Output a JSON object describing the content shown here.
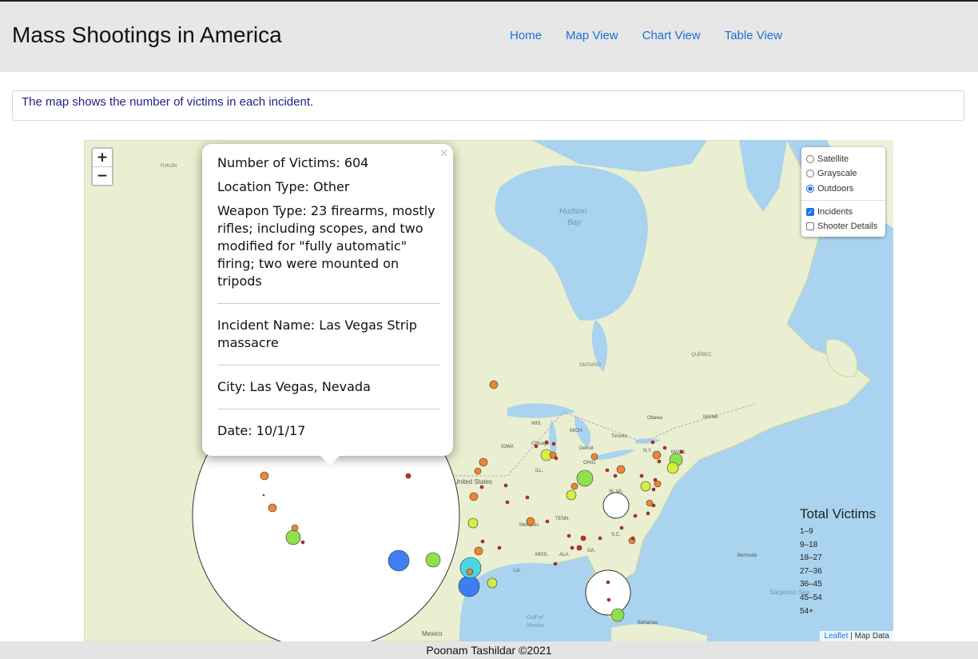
{
  "header": {
    "title": "Mass Shootings in America",
    "nav": [
      "Home",
      "Map View",
      "Chart View",
      "Table View"
    ]
  },
  "info": {
    "text": "The map shows the number of victims in each incident."
  },
  "map": {
    "zoom_in": "+",
    "zoom_out": "−",
    "layer_control": {
      "base_layers": [
        {
          "label": "Satellite",
          "selected": false
        },
        {
          "label": "Grayscale",
          "selected": false
        },
        {
          "label": "Outdoors",
          "selected": true
        }
      ],
      "overlays": [
        {
          "label": "Incidents",
          "checked": true
        },
        {
          "label": "Shooter Details",
          "checked": false
        }
      ]
    },
    "labels": {
      "hudson_bay_1": "Hudson",
      "hudson_bay_2": "Bay",
      "united_states": "United States",
      "mexico": "Mexico",
      "gulf_1": "Gulf of",
      "gulf_2": "Mexico",
      "bahamas": "Bahamas",
      "bermuda": "Bermuda",
      "sargasso": "Sargasso Sea",
      "quebec": "QUÉBEC",
      "ontario": "ONTARIO",
      "yukon": "YUKON",
      "ottawa": "Ottawa",
      "chicago": "Chicago",
      "toronto": "Toronto",
      "detroit": "Detroit",
      "memphis": "Memphis",
      "mass": "MASS.",
      "maine": "MAINE",
      "iowa": "IOWA",
      "ohio": "OHIO",
      "tenn": "TENN.",
      "ala": "ALA.",
      "miss": "MISS.",
      "la": "LA.",
      "ga": "GA.",
      "sc": "S.C.",
      "ny": "N.Y.",
      "wva": "W. VA.",
      "wis": "WIS.",
      "mich": "MICH.",
      "ill": "ILL."
    },
    "popup": {
      "close": "×",
      "victims": "Number of Victims: 604",
      "location_type": "Location Type: Other",
      "weapon_type": "Weapon Type: 23 firearms, mostly rifles; including scopes, and two modified for \"fully automatic\" firing; two were mounted on tripods",
      "incident_name": "Incident Name: Las Vegas Strip massacre",
      "city": "City: Las Vegas, Nevada",
      "date": "Date: 10/1/17"
    },
    "legend": {
      "title": "Total Victims",
      "items": [
        "1–9",
        "9–18",
        "18–27",
        "27–36",
        "36–45",
        "45–54",
        "54+"
      ]
    },
    "attribution": {
      "leaflet": "Leaflet",
      "sep": " | ",
      "data": "Map Data"
    },
    "marker_colors": {
      "1-9": "#d7191c",
      "9-18": "#f07d2a",
      "18-27": "#f6c338",
      "27-36": "#d4ee3a",
      "36-45": "#8bdf45",
      "45-54": "#3fd6e6",
      "54+": "#3477f2",
      "huge": "#ffffff"
    }
  },
  "footer": {
    "text": "Poonam Tashildar ©2021"
  }
}
